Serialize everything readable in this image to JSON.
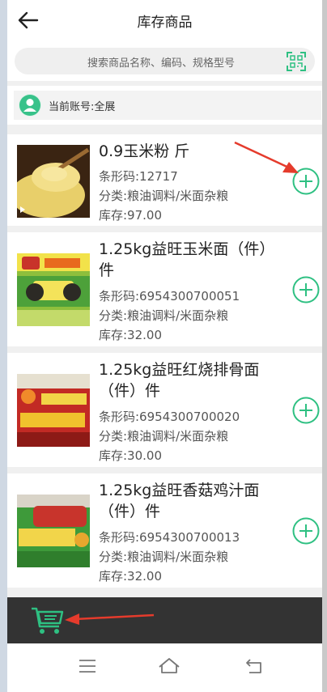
{
  "header": {
    "title": "库存商品"
  },
  "search": {
    "placeholder": "搜索商品名称、编码、规格型号"
  },
  "account": {
    "label": "当前账号:全展"
  },
  "colors": {
    "accent": "#2ec082",
    "annotation": "#e53b2c"
  },
  "products": [
    {
      "name": "0.9玉米粉 斤",
      "barcode": "条形码:12717",
      "category": "分类:粮油调料/米面杂粮",
      "stock": "库存:97.00"
    },
    {
      "name": "1.25kg益旺玉米面（件）件",
      "barcode": "条形码:6954300700051",
      "category": "分类:粮油调料/米面杂粮",
      "stock": "库存:32.00"
    },
    {
      "name": "1.25kg益旺红烧排骨面（件）件",
      "barcode": "条形码:6954300700020",
      "category": "分类:粮油调料/米面杂粮",
      "stock": "库存:30.00"
    },
    {
      "name": "1.25kg益旺香菇鸡汁面（件）件",
      "barcode": "条形码:6954300700013",
      "category": "分类:粮油调料/米面杂粮",
      "stock": "库存:32.00"
    }
  ],
  "icons": {
    "back": "arrow-left-icon",
    "scan": "scan-icon",
    "add": "plus-circle-icon",
    "cart": "cart-icon"
  }
}
